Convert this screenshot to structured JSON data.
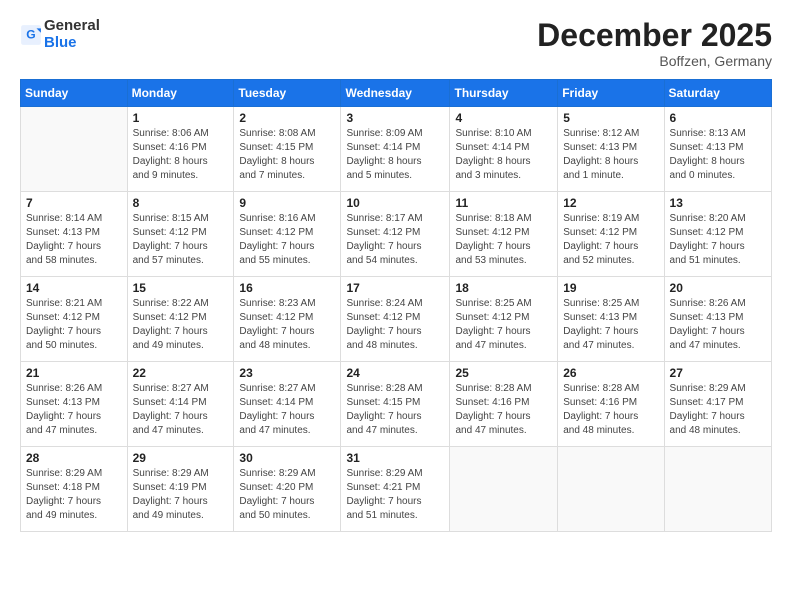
{
  "header": {
    "logo_general": "General",
    "logo_blue": "Blue",
    "month_title": "December 2025",
    "subtitle": "Boffzen, Germany"
  },
  "weekdays": [
    "Sunday",
    "Monday",
    "Tuesday",
    "Wednesday",
    "Thursday",
    "Friday",
    "Saturday"
  ],
  "weeks": [
    [
      {
        "day": "",
        "info": ""
      },
      {
        "day": "1",
        "info": "Sunrise: 8:06 AM\nSunset: 4:16 PM\nDaylight: 8 hours\nand 9 minutes."
      },
      {
        "day": "2",
        "info": "Sunrise: 8:08 AM\nSunset: 4:15 PM\nDaylight: 8 hours\nand 7 minutes."
      },
      {
        "day": "3",
        "info": "Sunrise: 8:09 AM\nSunset: 4:14 PM\nDaylight: 8 hours\nand 5 minutes."
      },
      {
        "day": "4",
        "info": "Sunrise: 8:10 AM\nSunset: 4:14 PM\nDaylight: 8 hours\nand 3 minutes."
      },
      {
        "day": "5",
        "info": "Sunrise: 8:12 AM\nSunset: 4:13 PM\nDaylight: 8 hours\nand 1 minute."
      },
      {
        "day": "6",
        "info": "Sunrise: 8:13 AM\nSunset: 4:13 PM\nDaylight: 8 hours\nand 0 minutes."
      }
    ],
    [
      {
        "day": "7",
        "info": "Sunrise: 8:14 AM\nSunset: 4:13 PM\nDaylight: 7 hours\nand 58 minutes."
      },
      {
        "day": "8",
        "info": "Sunrise: 8:15 AM\nSunset: 4:12 PM\nDaylight: 7 hours\nand 57 minutes."
      },
      {
        "day": "9",
        "info": "Sunrise: 8:16 AM\nSunset: 4:12 PM\nDaylight: 7 hours\nand 55 minutes."
      },
      {
        "day": "10",
        "info": "Sunrise: 8:17 AM\nSunset: 4:12 PM\nDaylight: 7 hours\nand 54 minutes."
      },
      {
        "day": "11",
        "info": "Sunrise: 8:18 AM\nSunset: 4:12 PM\nDaylight: 7 hours\nand 53 minutes."
      },
      {
        "day": "12",
        "info": "Sunrise: 8:19 AM\nSunset: 4:12 PM\nDaylight: 7 hours\nand 52 minutes."
      },
      {
        "day": "13",
        "info": "Sunrise: 8:20 AM\nSunset: 4:12 PM\nDaylight: 7 hours\nand 51 minutes."
      }
    ],
    [
      {
        "day": "14",
        "info": "Sunrise: 8:21 AM\nSunset: 4:12 PM\nDaylight: 7 hours\nand 50 minutes."
      },
      {
        "day": "15",
        "info": "Sunrise: 8:22 AM\nSunset: 4:12 PM\nDaylight: 7 hours\nand 49 minutes."
      },
      {
        "day": "16",
        "info": "Sunrise: 8:23 AM\nSunset: 4:12 PM\nDaylight: 7 hours\nand 48 minutes."
      },
      {
        "day": "17",
        "info": "Sunrise: 8:24 AM\nSunset: 4:12 PM\nDaylight: 7 hours\nand 48 minutes."
      },
      {
        "day": "18",
        "info": "Sunrise: 8:25 AM\nSunset: 4:12 PM\nDaylight: 7 hours\nand 47 minutes."
      },
      {
        "day": "19",
        "info": "Sunrise: 8:25 AM\nSunset: 4:13 PM\nDaylight: 7 hours\nand 47 minutes."
      },
      {
        "day": "20",
        "info": "Sunrise: 8:26 AM\nSunset: 4:13 PM\nDaylight: 7 hours\nand 47 minutes."
      }
    ],
    [
      {
        "day": "21",
        "info": "Sunrise: 8:26 AM\nSunset: 4:13 PM\nDaylight: 7 hours\nand 47 minutes."
      },
      {
        "day": "22",
        "info": "Sunrise: 8:27 AM\nSunset: 4:14 PM\nDaylight: 7 hours\nand 47 minutes."
      },
      {
        "day": "23",
        "info": "Sunrise: 8:27 AM\nSunset: 4:14 PM\nDaylight: 7 hours\nand 47 minutes."
      },
      {
        "day": "24",
        "info": "Sunrise: 8:28 AM\nSunset: 4:15 PM\nDaylight: 7 hours\nand 47 minutes."
      },
      {
        "day": "25",
        "info": "Sunrise: 8:28 AM\nSunset: 4:16 PM\nDaylight: 7 hours\nand 47 minutes."
      },
      {
        "day": "26",
        "info": "Sunrise: 8:28 AM\nSunset: 4:16 PM\nDaylight: 7 hours\nand 48 minutes."
      },
      {
        "day": "27",
        "info": "Sunrise: 8:29 AM\nSunset: 4:17 PM\nDaylight: 7 hours\nand 48 minutes."
      }
    ],
    [
      {
        "day": "28",
        "info": "Sunrise: 8:29 AM\nSunset: 4:18 PM\nDaylight: 7 hours\nand 49 minutes."
      },
      {
        "day": "29",
        "info": "Sunrise: 8:29 AM\nSunset: 4:19 PM\nDaylight: 7 hours\nand 49 minutes."
      },
      {
        "day": "30",
        "info": "Sunrise: 8:29 AM\nSunset: 4:20 PM\nDaylight: 7 hours\nand 50 minutes."
      },
      {
        "day": "31",
        "info": "Sunrise: 8:29 AM\nSunset: 4:21 PM\nDaylight: 7 hours\nand 51 minutes."
      },
      {
        "day": "",
        "info": ""
      },
      {
        "day": "",
        "info": ""
      },
      {
        "day": "",
        "info": ""
      }
    ]
  ]
}
